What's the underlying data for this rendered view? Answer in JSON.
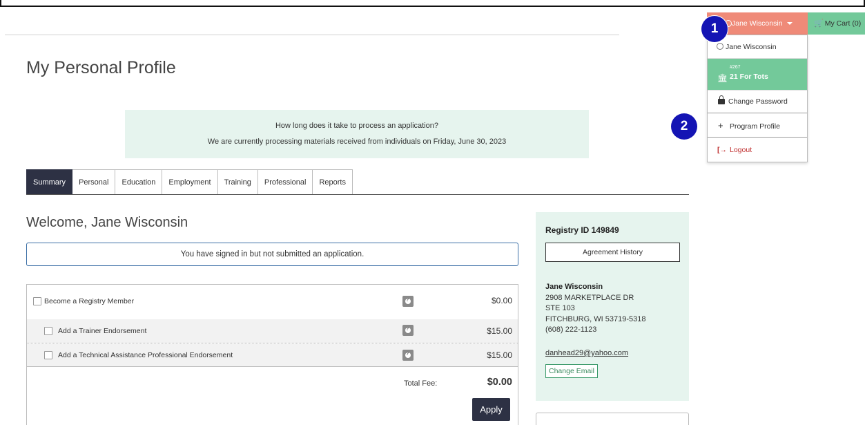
{
  "header": {
    "user_name": "Jane Wisconsin",
    "cart_label": "My Cart (0)"
  },
  "user_menu": {
    "profile_name": "Jane Wisconsin",
    "org_number": "#267",
    "org_name": "21 For Tots",
    "change_password": "Change Password",
    "program_profile": "Program Profile",
    "logout": "Logout"
  },
  "markers": [
    "1",
    "2"
  ],
  "page": {
    "title": "My Personal Profile"
  },
  "notice": {
    "question": "How long does it take to process an application?",
    "answer": "We are currently processing materials received from individuals on Friday, June 30, 2023"
  },
  "tabs": [
    "Summary",
    "Personal",
    "Education",
    "Employment",
    "Training",
    "Professional",
    "Reports"
  ],
  "active_tab": "Summary",
  "summary": {
    "welcome": "Welcome, Jane Wisconsin",
    "status": "You have signed in but not submitted an application.",
    "fees": [
      {
        "label": "Become a Registry Member",
        "amount": "$0.00"
      },
      {
        "label": "Add a Trainer Endorsement",
        "amount": "$15.00"
      },
      {
        "label": "Add a Technical Assistance Professional Endorsement",
        "amount": "$15.00"
      }
    ],
    "total_label": "Total Fee:",
    "total_amount": "$0.00",
    "apply_label": "Apply"
  },
  "side": {
    "registry_id": "Registry ID 149849",
    "agreement_history": "Agreement History",
    "name": "Jane Wisconsin",
    "address_lines": [
      "2908 MARKETPLACE DR",
      "STE 103",
      "FITCHBURG, WI 53719-5318",
      "(608) 222-1123"
    ],
    "email": "danhead29@yahoo.com",
    "change_email": "Change Email"
  },
  "colors": {
    "accent_dark": "#2d3144",
    "user_menu_bg": "#ef8a78",
    "cart_bg": "#73c99a",
    "notice_bg": "#e6f4ee",
    "marker": "#1414b4",
    "logout": "#c03030"
  },
  "icons": {
    "user": "user-circle-icon",
    "cart": "cart-icon",
    "bank": "bank-icon",
    "lock": "lock-icon",
    "plus": "plus-icon",
    "logout": "logout-icon",
    "help": "help-icon"
  }
}
